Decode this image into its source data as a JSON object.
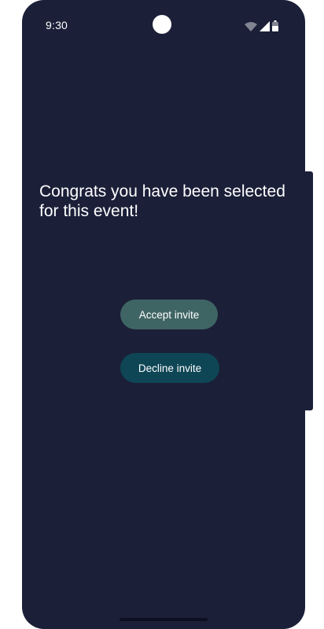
{
  "status_bar": {
    "time": "9:30",
    "icons": [
      "wifi-icon",
      "cellular-signal-icon",
      "battery-icon"
    ]
  },
  "main": {
    "headline": "Congrats you have been selected for this event!",
    "accept_button": {
      "label": "Accept invite"
    },
    "decline_button": {
      "label": "Decline invite"
    }
  },
  "colors": {
    "background": "#1b1f38",
    "accept_button": "#3f6464",
    "decline_button": "#0e4655",
    "text": "#ffffff"
  }
}
